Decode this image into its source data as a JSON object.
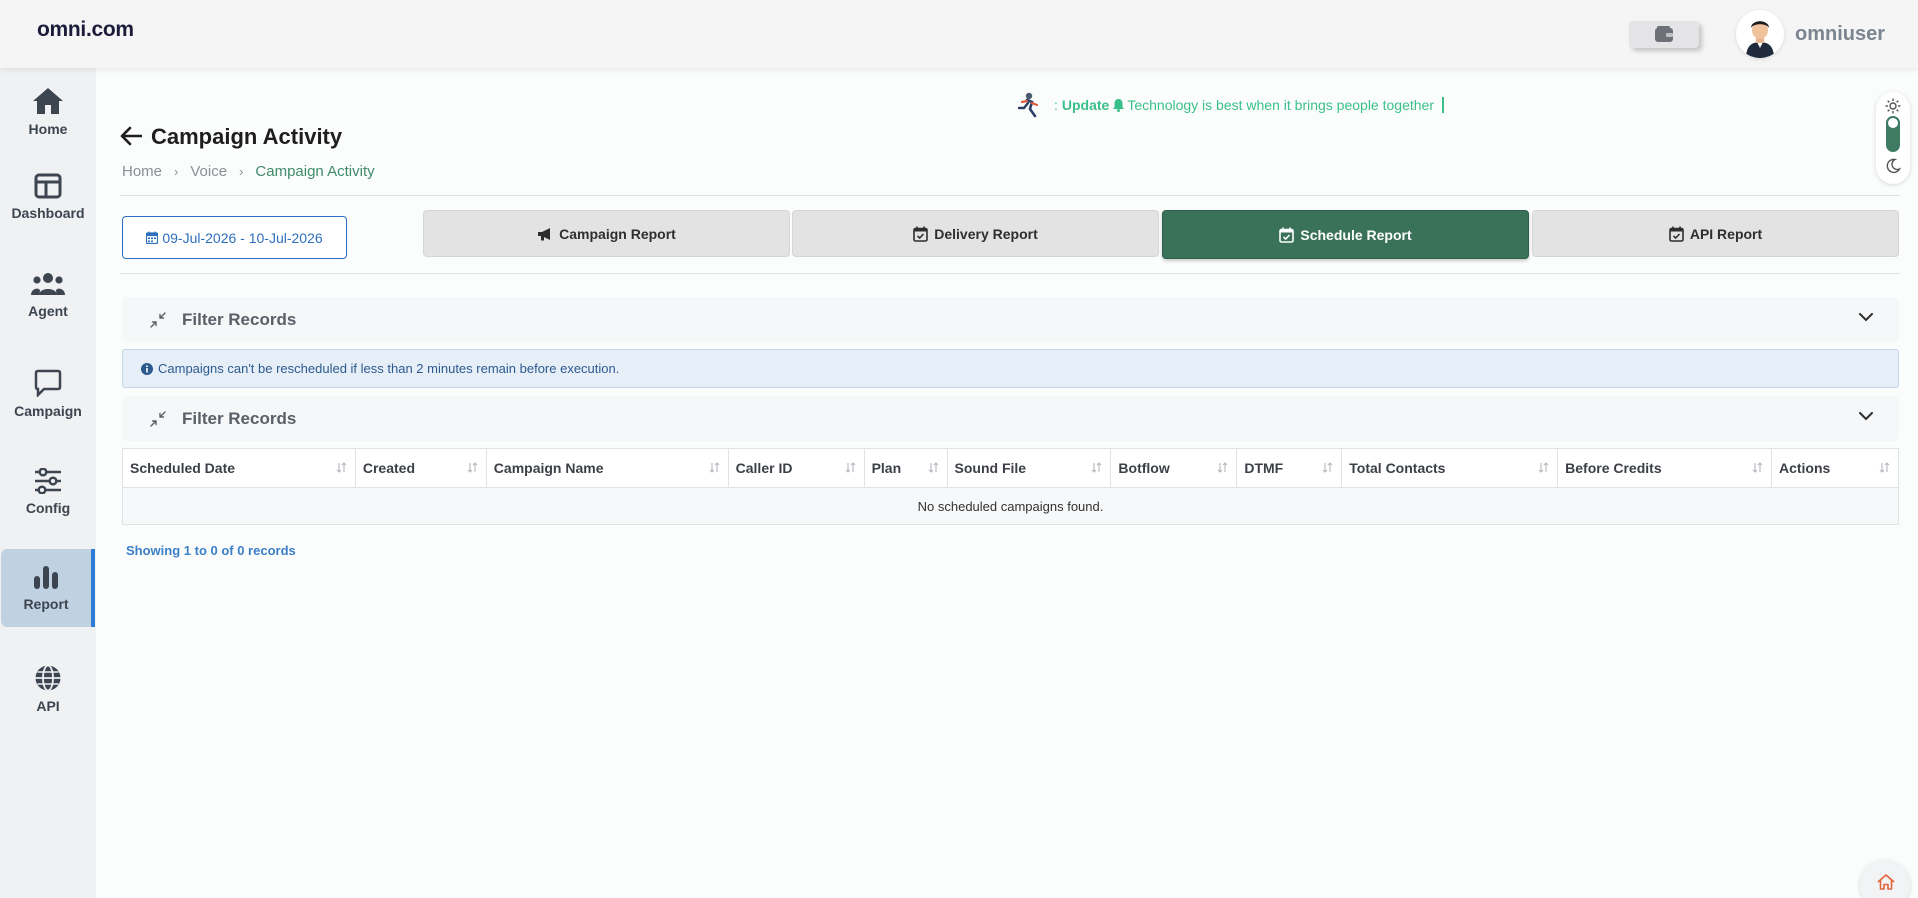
{
  "header": {
    "logo": "omni.com",
    "username": "omniuser"
  },
  "sidebar": {
    "items": [
      {
        "label": "Home",
        "icon": "home-icon"
      },
      {
        "label": "Dashboard",
        "icon": "dashboard-icon"
      },
      {
        "label": "Agent",
        "icon": "users-icon"
      },
      {
        "label": "Campaign",
        "icon": "chat-icon"
      },
      {
        "label": "Config",
        "icon": "sliders-icon"
      },
      {
        "label": "Report",
        "icon": "bar-chart-icon",
        "active": true
      },
      {
        "label": "API",
        "icon": "globe-icon"
      }
    ]
  },
  "ticker": {
    "prefix": ":",
    "update_label": "Update",
    "message": "Technology is best when it brings people together"
  },
  "page": {
    "title": "Campaign Activity",
    "breadcrumb": [
      "Home",
      "Voice",
      "Campaign Activity"
    ]
  },
  "date_range": "09-Jul-2026 - 10-Jul-2026",
  "report_tabs": [
    {
      "label": "Campaign Report",
      "icon": "megaphone-icon"
    },
    {
      "label": "Delivery Report",
      "icon": "calendar-check-icon"
    },
    {
      "label": "Schedule Report",
      "icon": "calendar-check-icon",
      "active": true
    },
    {
      "label": "API Report",
      "icon": "calendar-check-icon"
    }
  ],
  "filters": {
    "first_title": "Filter Records",
    "second_title": "Filter Records"
  },
  "notice": "Campaigns can't be rescheduled if less than 2 minutes remain before execution.",
  "table": {
    "columns": [
      "Scheduled Date",
      "Created",
      "Campaign Name",
      "Caller ID",
      "Plan",
      "Sound File",
      "Botflow",
      "DTMF",
      "Total Contacts",
      "Before Credits",
      "Actions"
    ],
    "empty_message": "No scheduled campaigns found."
  },
  "pagination": {
    "summary": "Showing 1 to 0 of 0 records"
  },
  "colors": {
    "accent_green": "#3a7259",
    "ticker_green": "#3bbf8a",
    "link_blue": "#2e6fbd",
    "sidebar_active": "#c0d2e2"
  }
}
